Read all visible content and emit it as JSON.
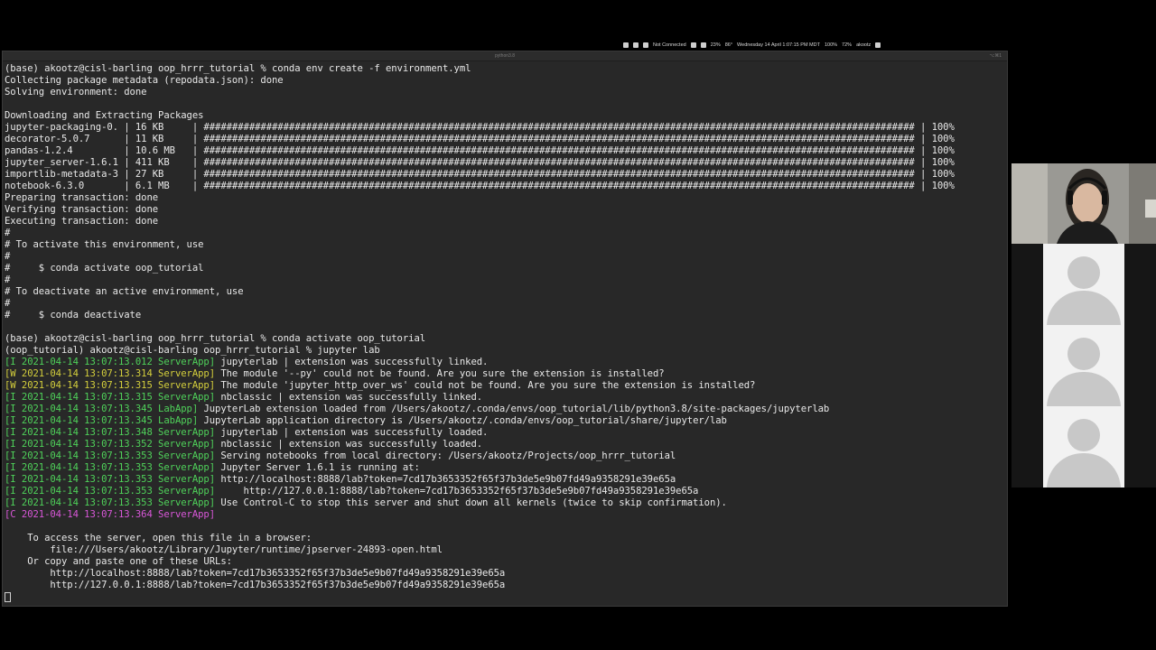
{
  "menubar": {
    "not_connected": "Not Connected",
    "battery_left": "23%",
    "temp": "86°",
    "datetime": "Wednesday 14 April 1:07:15 PM MDT",
    "battery_right": "100%",
    "volume": "72%",
    "user": "akootz"
  },
  "terminal": {
    "title": "python3.8",
    "title_right": "⌥⌘1",
    "lines": [
      {
        "segs": [
          {
            "t": "(base) akootz@cisl-barling oop_hrrr_tutorial % conda env create -f environment.yml"
          }
        ]
      },
      {
        "segs": [
          {
            "t": "Collecting package metadata (repodata.json): done"
          }
        ]
      },
      {
        "segs": [
          {
            "t": "Solving environment: done"
          }
        ]
      },
      {
        "segs": [
          {
            "t": ""
          }
        ]
      },
      {
        "segs": [
          {
            "t": "Downloading and Extracting Packages"
          }
        ]
      },
      {
        "segs": [
          {
            "t": "jupyter-packaging-0. | 16 KB     | ############################################################################################################################# | 100%"
          }
        ]
      },
      {
        "segs": [
          {
            "t": "decorator-5.0.7      | 11 KB     | ############################################################################################################################# | 100%"
          }
        ]
      },
      {
        "segs": [
          {
            "t": "pandas-1.2.4         | 10.6 MB   | ############################################################################################################################# | 100%"
          }
        ]
      },
      {
        "segs": [
          {
            "t": "jupyter_server-1.6.1 | 411 KB    | ############################################################################################################################# | 100%"
          }
        ]
      },
      {
        "segs": [
          {
            "t": "importlib-metadata-3 | 27 KB     | ############################################################################################################################# | 100%"
          }
        ]
      },
      {
        "segs": [
          {
            "t": "notebook-6.3.0       | 6.1 MB    | ############################################################################################################################# | 100%"
          }
        ]
      },
      {
        "segs": [
          {
            "t": "Preparing transaction: done"
          }
        ]
      },
      {
        "segs": [
          {
            "t": "Verifying transaction: done"
          }
        ]
      },
      {
        "segs": [
          {
            "t": "Executing transaction: done"
          }
        ]
      },
      {
        "segs": [
          {
            "t": "#"
          }
        ]
      },
      {
        "segs": [
          {
            "t": "# To activate this environment, use"
          }
        ]
      },
      {
        "segs": [
          {
            "t": "#"
          }
        ]
      },
      {
        "segs": [
          {
            "t": "#     $ conda activate oop_tutorial"
          }
        ]
      },
      {
        "segs": [
          {
            "t": "#"
          }
        ]
      },
      {
        "segs": [
          {
            "t": "# To deactivate an active environment, use"
          }
        ]
      },
      {
        "segs": [
          {
            "t": "#"
          }
        ]
      },
      {
        "segs": [
          {
            "t": "#     $ conda deactivate"
          }
        ]
      },
      {
        "segs": [
          {
            "t": ""
          }
        ]
      },
      {
        "segs": [
          {
            "t": "(base) akootz@cisl-barling oop_hrrr_tutorial % conda activate oop_tutorial"
          }
        ]
      },
      {
        "segs": [
          {
            "t": "(oop_tutorial) akootz@cisl-barling oop_hrrr_tutorial % jupyter lab"
          }
        ]
      },
      {
        "segs": [
          {
            "t": "[I 2021-04-14 13:07:13.012 ServerApp]",
            "c": "tI"
          },
          {
            "t": " jupyterlab | extension was successfully linked."
          }
        ]
      },
      {
        "segs": [
          {
            "t": "[W 2021-04-14 13:07:13.314 ServerApp]",
            "c": "tW"
          },
          {
            "t": " The module '--py' could not be found. Are you sure the extension is installed?"
          }
        ]
      },
      {
        "segs": [
          {
            "t": "[W 2021-04-14 13:07:13.315 ServerApp]",
            "c": "tW"
          },
          {
            "t": " The module 'jupyter_http_over_ws' could not be found. Are you sure the extension is installed?"
          }
        ]
      },
      {
        "segs": [
          {
            "t": "[I 2021-04-14 13:07:13.315 ServerApp]",
            "c": "tI"
          },
          {
            "t": " nbclassic | extension was successfully linked."
          }
        ]
      },
      {
        "segs": [
          {
            "t": "[I 2021-04-14 13:07:13.345 LabApp]",
            "c": "tI"
          },
          {
            "t": " JupyterLab extension loaded from /Users/akootz/.conda/envs/oop_tutorial/lib/python3.8/site-packages/jupyterlab"
          }
        ]
      },
      {
        "segs": [
          {
            "t": "[I 2021-04-14 13:07:13.345 LabApp]",
            "c": "tI"
          },
          {
            "t": " JupyterLab application directory is /Users/akootz/.conda/envs/oop_tutorial/share/jupyter/lab"
          }
        ]
      },
      {
        "segs": [
          {
            "t": "[I 2021-04-14 13:07:13.348 ServerApp]",
            "c": "tI"
          },
          {
            "t": " jupyterlab | extension was successfully loaded."
          }
        ]
      },
      {
        "segs": [
          {
            "t": "[I 2021-04-14 13:07:13.352 ServerApp]",
            "c": "tI"
          },
          {
            "t": " nbclassic | extension was successfully loaded."
          }
        ]
      },
      {
        "segs": [
          {
            "t": "[I 2021-04-14 13:07:13.353 ServerApp]",
            "c": "tI"
          },
          {
            "t": " Serving notebooks from local directory: /Users/akootz/Projects/oop_hrrr_tutorial"
          }
        ]
      },
      {
        "segs": [
          {
            "t": "[I 2021-04-14 13:07:13.353 ServerApp]",
            "c": "tI"
          },
          {
            "t": " Jupyter Server 1.6.1 is running at:"
          }
        ]
      },
      {
        "segs": [
          {
            "t": "[I 2021-04-14 13:07:13.353 ServerApp]",
            "c": "tI"
          },
          {
            "t": " http://localhost:8888/lab?token=7cd17b3653352f65f37b3de5e9b07fd49a9358291e39e65a"
          }
        ]
      },
      {
        "segs": [
          {
            "t": "[I 2021-04-14 13:07:13.353 ServerApp]",
            "c": "tI"
          },
          {
            "t": "     http://127.0.0.1:8888/lab?token=7cd17b3653352f65f37b3de5e9b07fd49a9358291e39e65a"
          }
        ]
      },
      {
        "segs": [
          {
            "t": "[I 2021-04-14 13:07:13.353 ServerApp]",
            "c": "tI"
          },
          {
            "t": " Use Control-C to stop this server and shut down all kernels (twice to skip confirmation)."
          }
        ]
      },
      {
        "segs": [
          {
            "t": "[C 2021-04-14 13:07:13.364 ServerApp]",
            "c": "tC"
          }
        ]
      },
      {
        "segs": [
          {
            "t": ""
          }
        ]
      },
      {
        "segs": [
          {
            "t": "    To access the server, open this file in a browser:"
          }
        ]
      },
      {
        "segs": [
          {
            "t": "        file:///Users/akootz/Library/Jupyter/runtime/jpserver-24893-open.html"
          }
        ]
      },
      {
        "segs": [
          {
            "t": "    Or copy and paste one of these URLs:"
          }
        ]
      },
      {
        "segs": [
          {
            "t": "        http://localhost:8888/lab?token=7cd17b3653352f65f37b3de5e9b07fd49a9358291e39e65a"
          }
        ]
      },
      {
        "segs": [
          {
            "t": "        http://127.0.0.1:8888/lab?token=7cd17b3653352f65f37b3de5e9b07fd49a9358291e39e65a"
          }
        ]
      }
    ]
  },
  "colors": {
    "info": "#4fd25a",
    "warning": "#d4cf3c",
    "critical": "#d957d9",
    "terminal_bg": "#282828"
  },
  "participants": [
    "avatar",
    "avatar",
    "avatar"
  ]
}
